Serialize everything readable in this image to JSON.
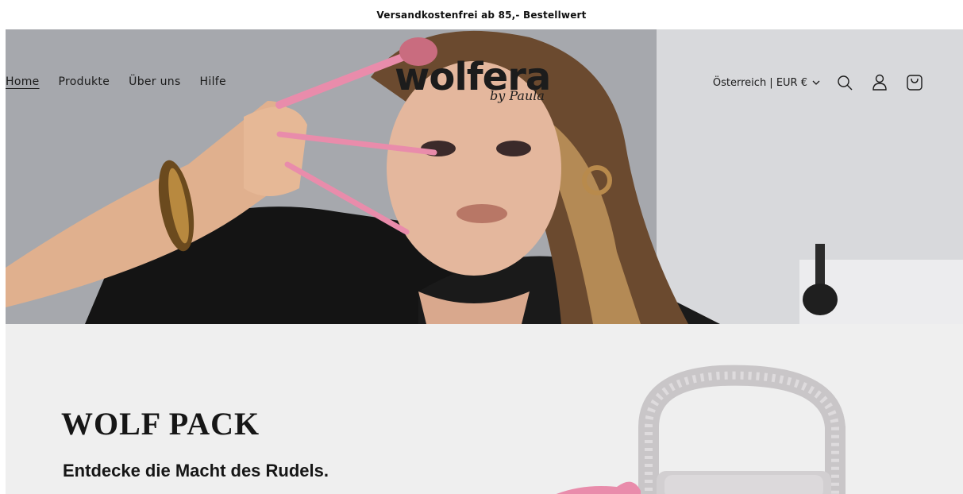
{
  "announcement": "Versandkostenfrei ab 85,- Bestellwert",
  "nav": {
    "items": [
      {
        "label": "Home",
        "active": true
      },
      {
        "label": "Produkte",
        "active": false
      },
      {
        "label": "Über uns",
        "active": false
      },
      {
        "label": "Hilfe",
        "active": false
      }
    ]
  },
  "logo": {
    "main": "wolfera",
    "sub": "by Paula"
  },
  "tools": {
    "country": "Österreich | EUR €",
    "icons": [
      "search-icon",
      "account-icon",
      "cart-icon"
    ]
  },
  "feature": {
    "title": "WOLF PACK",
    "subtitle": "Entdecke die Macht des Rudels."
  },
  "colors": {
    "brush_pink": "#e98cab",
    "background_light": "#efefef",
    "text_dark": "#121212"
  }
}
